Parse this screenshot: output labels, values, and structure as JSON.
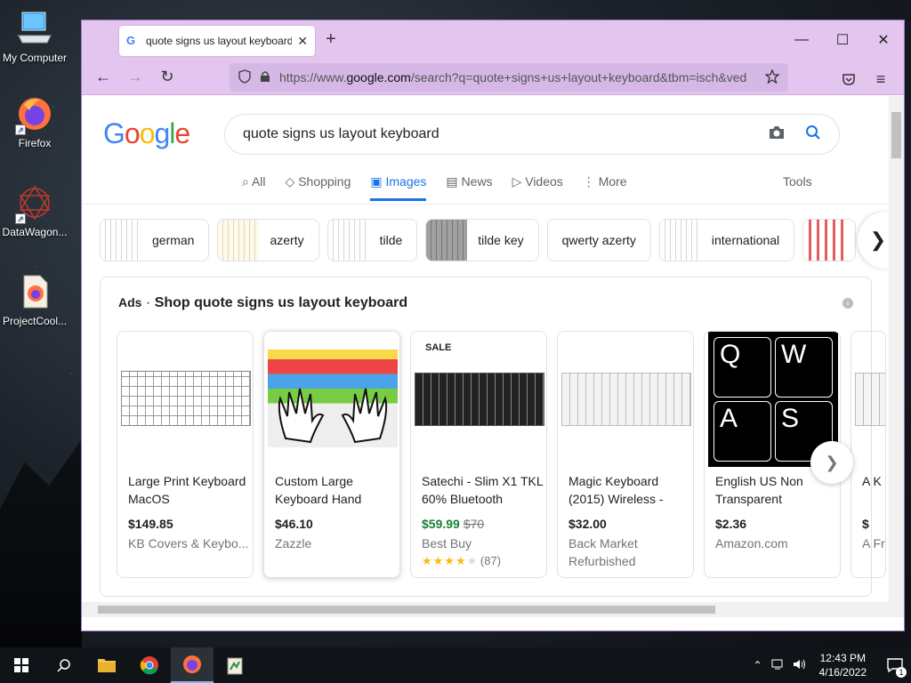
{
  "desktop": {
    "icons": [
      {
        "label": "My Computer"
      },
      {
        "label": "Firefox"
      },
      {
        "label": "DataWagon..."
      },
      {
        "label": "ProjectCool..."
      }
    ]
  },
  "browser": {
    "tab_title": "quote signs us layout keyboard",
    "tab_close": "✕",
    "new_tab": "+",
    "url_prefix": "https://www.",
    "url_domain": "google.com",
    "url_rest": "/search?q=quote+signs+us+layout+keyboard&tbm=isch&ved"
  },
  "google": {
    "logo": [
      "G",
      "o",
      "o",
      "g",
      "l",
      "e"
    ],
    "logo_colors": [
      "#4285f4",
      "#ea4335",
      "#fbbc05",
      "#4285f4",
      "#34a853",
      "#ea4335"
    ],
    "query": "quote signs us layout keyboard",
    "tabs": [
      {
        "label": "All",
        "icon": "🔍"
      },
      {
        "label": "Shopping",
        "icon": "◇"
      },
      {
        "label": "Images",
        "icon": "▣"
      },
      {
        "label": "News",
        "icon": "▤"
      },
      {
        "label": "Videos",
        "icon": "▷"
      },
      {
        "label": "More",
        "icon": "⋮"
      }
    ],
    "tools": "Tools",
    "chips": [
      "german",
      "azerty",
      "tilde",
      "tilde key",
      "qwerty azerty",
      "international"
    ]
  },
  "ads": {
    "label": "Ads",
    "separator": "·",
    "title": "Shop quote signs us layout keyboard",
    "products": [
      {
        "name": "Large Print Keyboard MacOS",
        "price": "$149.85",
        "store": "KB Covers & Keybo..."
      },
      {
        "name": "Custom Large Keyboard Hand",
        "price": "$46.10",
        "store": "Zazzle"
      },
      {
        "name": "Satechi - Slim X1 TKL 60% Bluetooth",
        "price": "$59.99",
        "old_price": "$70",
        "store": "Best Buy",
        "badge": "SALE",
        "stars": "★★★★",
        "half": "★",
        "reviews": "(87)"
      },
      {
        "name": "Magic Keyboard (2015) Wireless -",
        "price": "$32.00",
        "store": "Back Market Refurbished"
      },
      {
        "name": "English US Non Transparent",
        "price": "$2.36",
        "store": "Amazon.com",
        "sticker_keys": [
          "Q",
          "W",
          "A",
          "S"
        ]
      },
      {
        "name": "A K",
        "price": "$",
        "store": "A Fr"
      }
    ]
  },
  "taskbar": {
    "time": "12:43 PM",
    "date": "4/16/2022",
    "notifications": "1"
  },
  "colors": {
    "browser_chrome": "#e3c5f0",
    "google_blue": "#1a73e8",
    "sale_green": "#188038"
  }
}
